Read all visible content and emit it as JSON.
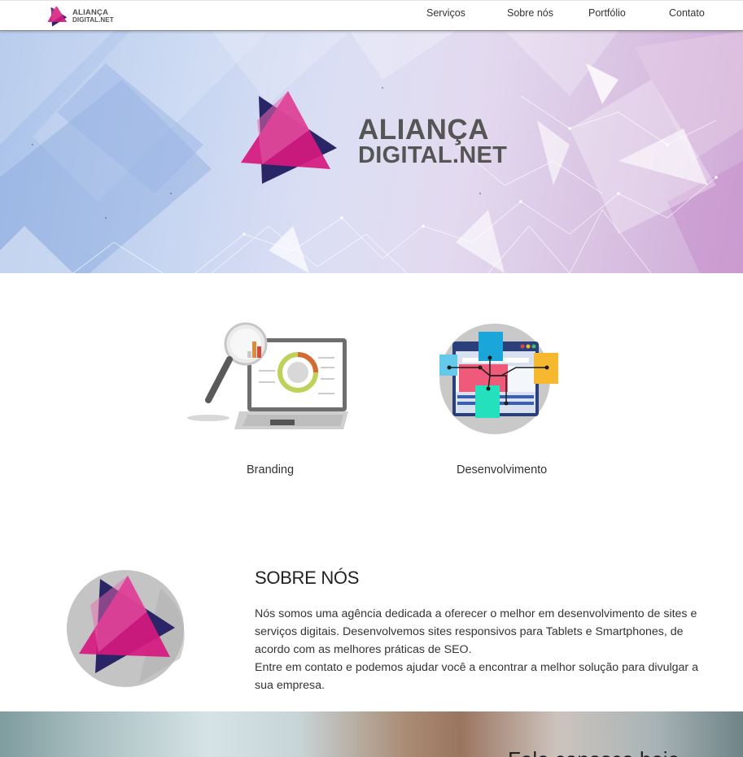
{
  "brand": {
    "line1": "ALIANÇA",
    "line2": "DIGITAL.NET"
  },
  "nav": {
    "items": [
      {
        "label": "Serviços"
      },
      {
        "label": "Sobre nós"
      },
      {
        "label": "Portfólio"
      },
      {
        "label": "Contato"
      }
    ]
  },
  "hero": {
    "logo_line1": "ALIANÇA",
    "logo_line2": "DIGITAL.NET"
  },
  "services": [
    {
      "label": "Branding",
      "icon": "laptop-magnifier-icon"
    },
    {
      "label": "Desenvolvimento",
      "icon": "web-development-icon"
    }
  ],
  "about": {
    "title": "SOBRE NÓS",
    "paragraph1": "Nós somos uma agência dedicada a oferecer o melhor em desenvolvimento de sites e serviços digitais. Desenvolvemos sites responsivos para Tablets e Smartphones, de acordo com as melhores práticas de SEO.",
    "paragraph2": "Entre em contato e podemos ajudar você a encontrar a melhor solução para divulgar a sua empresa."
  },
  "banner": {
    "partial_text": "Fale conosco hoje"
  },
  "colors": {
    "magenta": "#d6187f",
    "navy": "#2a2566",
    "pink": "#e05aa5",
    "text_gray": "#555555"
  }
}
